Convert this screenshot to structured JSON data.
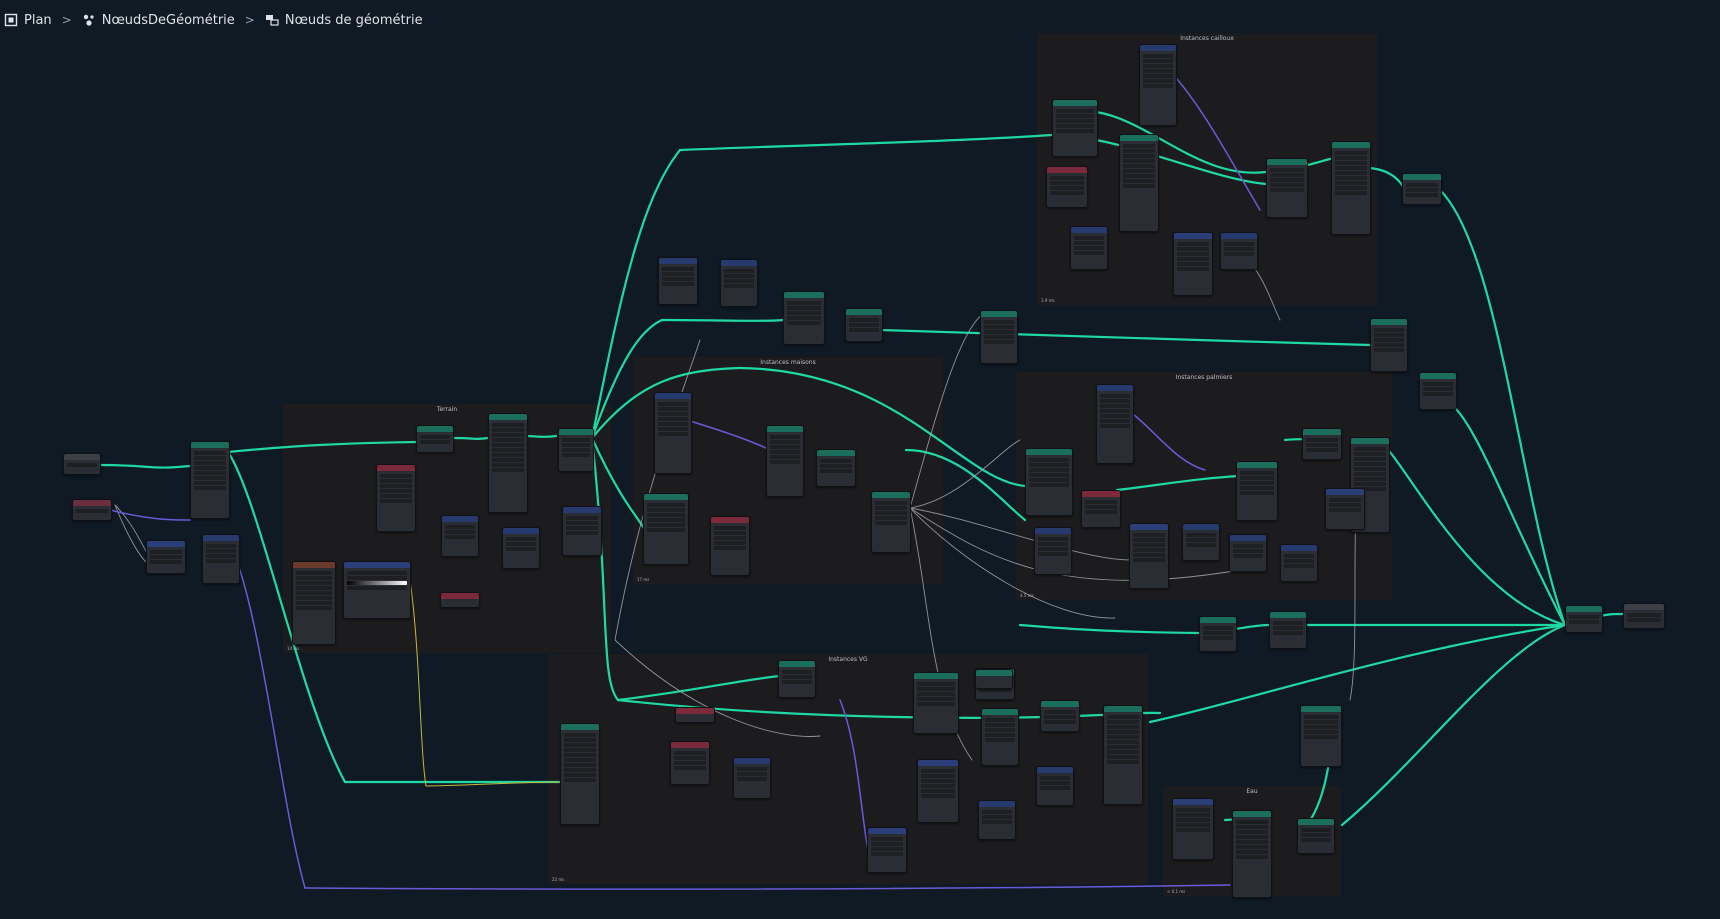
{
  "breadcrumb": {
    "items": [
      {
        "label": "Plan",
        "icon": "scene-icon"
      },
      {
        "label": "NœudsDeGéométrie",
        "icon": "modifier-icon"
      },
      {
        "label": "Nœuds de géométrie",
        "icon": "node-tree-icon"
      }
    ]
  },
  "frames": [
    {
      "title": "Instances cailloux",
      "timing": "3.9 ms"
    },
    {
      "title": "Terrain",
      "timing": "14 ms"
    },
    {
      "title": "Instances maisons",
      "timing": "17 ms"
    },
    {
      "title": "Instances palmiers",
      "timing": "4.5 ms"
    },
    {
      "title": "Instances VG",
      "timing": "22 ms"
    },
    {
      "title": "Eau",
      "timing": "< 0.1 ms"
    }
  ],
  "colors": {
    "background": "#0f1a24",
    "frame": "#1c1c1f",
    "geometry_wire": "#1fd9a3",
    "grey_wire": "#a4a9b0",
    "purple_wire": "#6a5ad8",
    "yellow_wire": "#c8b63a",
    "node_body": "#2a2d33",
    "header_geometry": "#1a6e5b",
    "header_math": "#263a6e",
    "header_input": "#6b2e3f"
  }
}
